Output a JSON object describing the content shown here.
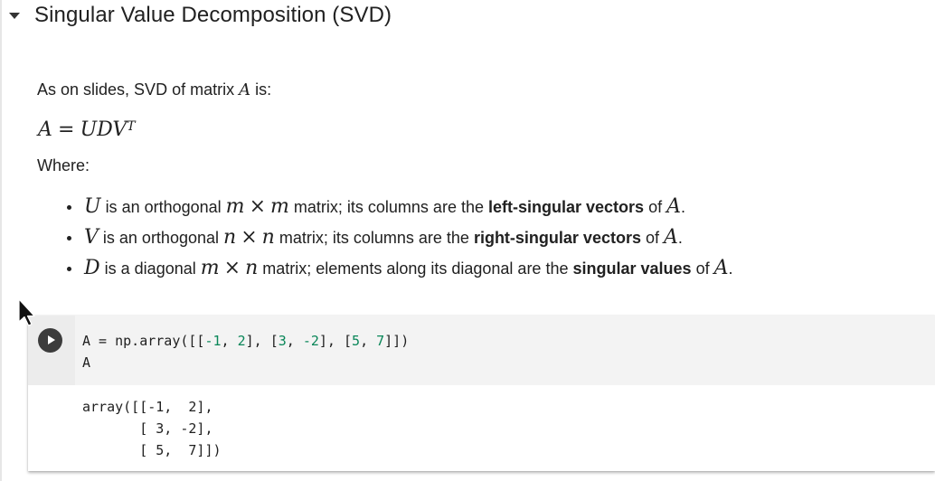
{
  "section": {
    "title": "Singular Value Decomposition (SVD)"
  },
  "markdown": {
    "intro_text": "As on slides, SVD of matrix",
    "intro_var": "A",
    "intro_end": "is:",
    "equation": {
      "lhs": "A",
      "equals": "=",
      "rhs": "UDV",
      "sup": "T"
    },
    "where": "Where:",
    "bullets": [
      {
        "var": "U",
        "t1": "is an orthogonal",
        "dim": [
          "m",
          "×",
          "m"
        ],
        "t2": "matrix; its columns are the",
        "bold": "left-singular vectors",
        "t3": "of",
        "end_var": "A",
        "period": "."
      },
      {
        "var": "V",
        "t1": "is an orthogonal",
        "dim": [
          "n",
          "×",
          "n"
        ],
        "t2": "matrix; its columns are the",
        "bold": "right-singular vectors",
        "t3": "of",
        "end_var": "A",
        "period": "."
      },
      {
        "var": "D",
        "t1": "is a diagonal",
        "dim": [
          "m",
          "×",
          "n"
        ],
        "t2": "matrix; elements along its diagonal are the",
        "bold": "singular values",
        "t3": "of",
        "end_var": "A",
        "period": "."
      }
    ]
  },
  "code_cell": {
    "code_tokens": {
      "p1": "A = np.array([[",
      "n1": "-1",
      "p2": ", ",
      "n2": "2",
      "p3": "], [",
      "n3": "3",
      "p4": ", ",
      "n4": "-2",
      "p5": "], [",
      "n5": "5",
      "p6": ", ",
      "n6": "7",
      "p7": "]])"
    },
    "code_line2": "A",
    "output_lines": [
      "array([[-1,  2],",
      "       [ 3, -2],",
      "       [ 5,  7]])"
    ]
  },
  "colors": {
    "number_literal": "#098658",
    "editor_bg": "#f3f3f3",
    "gutter_bg": "#ececec",
    "run_button": "#3c3c3c"
  },
  "icons": {
    "collapse": "triangle-down",
    "run": "play-circle",
    "pointer": "mouse-cursor"
  }
}
